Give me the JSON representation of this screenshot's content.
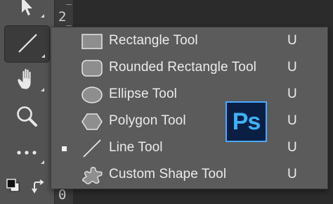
{
  "ruler": {
    "top_number": "2",
    "bottom_number": "0"
  },
  "toolbar": {
    "tools": [
      {
        "name": "move-tool",
        "icon": "arrow-cursor-icon"
      },
      {
        "name": "line-tool",
        "icon": "line-icon",
        "selected": true
      },
      {
        "name": "hand-tool",
        "icon": "hand-icon"
      },
      {
        "name": "zoom-tool",
        "icon": "magnifier-icon"
      },
      {
        "name": "more-tools",
        "icon": "ellipsis-icon"
      },
      {
        "name": "default-colors",
        "icon": "default-colors-icon"
      },
      {
        "name": "swap-colors",
        "icon": "swap-arrows-icon"
      }
    ]
  },
  "menu": {
    "items": [
      {
        "label": "Rectangle Tool",
        "shortcut": "U",
        "icon": "rectangle-icon",
        "active": false
      },
      {
        "label": "Rounded Rectangle Tool",
        "shortcut": "U",
        "icon": "rounded-rectangle-icon",
        "active": false
      },
      {
        "label": "Ellipse Tool",
        "shortcut": "U",
        "icon": "ellipse-icon",
        "active": false
      },
      {
        "label": "Polygon Tool",
        "shortcut": "U",
        "icon": "polygon-icon",
        "active": false
      },
      {
        "label": "Line Tool",
        "shortcut": "U",
        "icon": "line-icon",
        "active": true
      },
      {
        "label": "Custom Shape Tool",
        "shortcut": "U",
        "icon": "custom-shape-icon",
        "active": false
      }
    ]
  },
  "logo": {
    "text": "Ps"
  },
  "colors": {
    "toolbar_bg": "#535353",
    "menu_bg": "#5b5b5b",
    "text": "#ececec",
    "logo_bg": "#0b1f45",
    "logo_accent": "#3db3f5"
  }
}
